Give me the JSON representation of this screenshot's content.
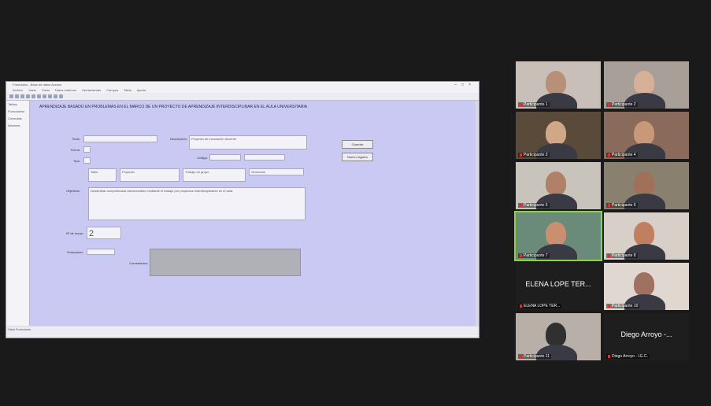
{
  "shared_app": {
    "title": "Formulario - Base de datos Access",
    "menu": [
      "Archivo",
      "Inicio",
      "Crear",
      "Datos externos",
      "Herramientas",
      "Campos",
      "Tabla",
      "Ayuda"
    ],
    "nav_items": [
      "Tablas",
      "Formularios",
      "Consultas",
      "Informes"
    ],
    "form_title": "APRENDIZAJE BASADO EN PROBLEMAS EN EL MARCO DE UN PROYECTO DE APRENDIZAJE INTERDISCIPLINAR EN EL AULA UNIVERSITARIA",
    "fields": {
      "name_label": "Título:",
      "name_value": "",
      "desc_label": "Descripción:",
      "desc_value": "Proyecto de innovación docente",
      "date_label": "Fecha:",
      "date_value": "",
      "type_label": "Tipo:",
      "code_label": "Código:",
      "code_value": "",
      "opt1": "Taller",
      "opt2": "Proyecto",
      "opt3": "Trabajo en grupo",
      "opt4": "Seminario",
      "desc2_label": "Objetivos:",
      "desc2_value": "Desarrollar competencias transversales mediante el trabajo por proyectos interdisciplinares en el aula.",
      "hours_label": "Nº de horas:",
      "hours_value": "2",
      "eval_label": "Evaluación:",
      "eval_value": "",
      "comments_label": "Comentarios:"
    },
    "buttons": [
      "Guardar",
      "Nuevo registro"
    ],
    "status": "Vista Formulario"
  },
  "participants": [
    {
      "name": "Participante 1",
      "bg": "#c8c0b8",
      "skin": "#b89078",
      "active": false
    },
    {
      "name": "Participante 2",
      "bg": "#a8a098",
      "skin": "#d8b098",
      "active": false
    },
    {
      "name": "Participante 3",
      "bg": "#5a4a3a",
      "skin": "#d0a888",
      "active": false
    },
    {
      "name": "Participante 4",
      "bg": "#8a6a5a",
      "skin": "#c89878",
      "active": false
    },
    {
      "name": "Participante 5",
      "bg": "#c8c4bc",
      "skin": "#b08068",
      "active": false
    },
    {
      "name": "Participante 6",
      "bg": "#8a8070",
      "skin": "#a07058",
      "active": false
    },
    {
      "name": "Participante 7",
      "bg": "#6a8a7a",
      "skin": "#c89070",
      "active": true
    },
    {
      "name": "Participante 8",
      "bg": "#d8d0c8",
      "skin": "#c08060",
      "active": false
    },
    {
      "name": "ELENA LOPE TER...",
      "bg": "#1e1e1e",
      "skin": "",
      "active": false,
      "big": "ELENA LOPE TER..."
    },
    {
      "name": "Participante 10",
      "bg": "#e0d8d0",
      "skin": "#a07060",
      "active": false
    },
    {
      "name": "Participante 11",
      "bg": "#b8b0a8",
      "skin": "#303030",
      "active": false
    },
    {
      "name": "Diego Arroyo - I.E.C.",
      "bg": "#1e1e1e",
      "skin": "",
      "active": false,
      "big": "Diego Arroyo -..."
    }
  ]
}
